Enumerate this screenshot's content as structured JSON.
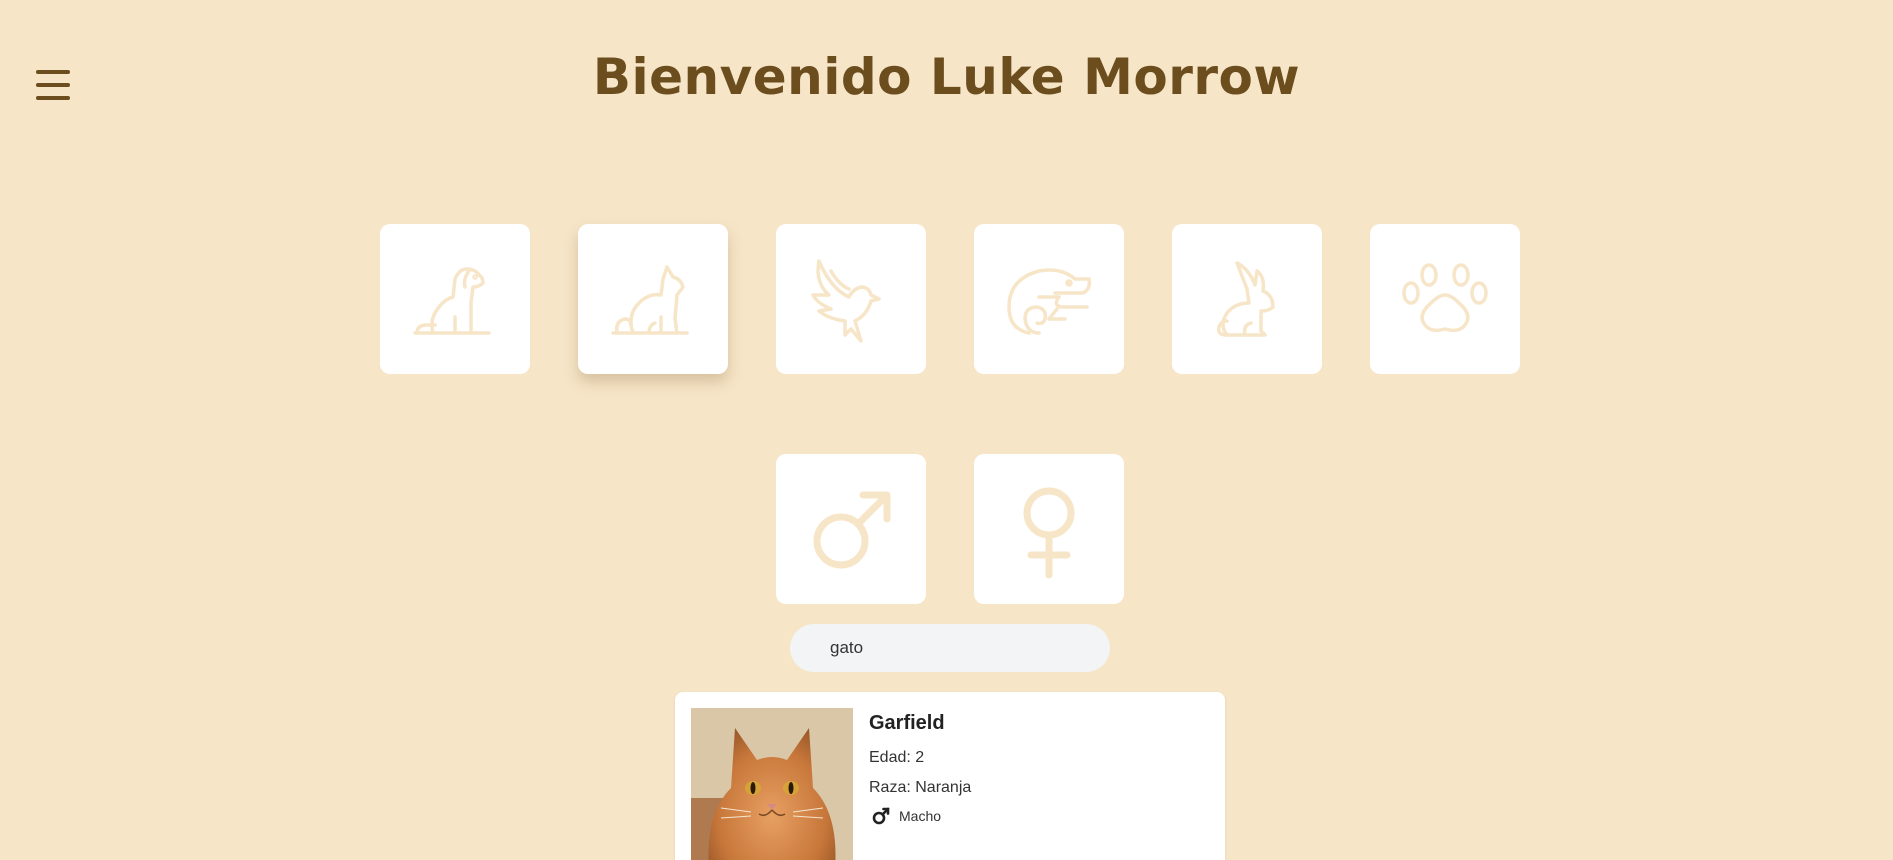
{
  "header": {
    "menu_icon": "hamburger-menu-icon",
    "title": "Bienvenido Luke Morrow"
  },
  "animal_filters": [
    {
      "icon": "dog-icon",
      "selected": false
    },
    {
      "icon": "cat-icon",
      "selected": true
    },
    {
      "icon": "bird-icon",
      "selected": false
    },
    {
      "icon": "reptile-icon",
      "selected": false
    },
    {
      "icon": "rabbit-icon",
      "selected": false
    },
    {
      "icon": "paw-icon",
      "selected": false
    }
  ],
  "gender_filters": [
    {
      "icon": "male-icon"
    },
    {
      "icon": "female-icon"
    }
  ],
  "search": {
    "value": "gato"
  },
  "results": [
    {
      "name": "Garfield",
      "age_label": "Edad: ",
      "age": "2",
      "breed_label": "Raza: ",
      "breed": "Naranja",
      "sex_icon": "male-icon",
      "sex": "Macho"
    }
  ],
  "colors": {
    "background": "#f7e5c8",
    "title": "#6b4d1e",
    "tile": "#ffffff",
    "icon_stroke": "#f7e5c8"
  }
}
